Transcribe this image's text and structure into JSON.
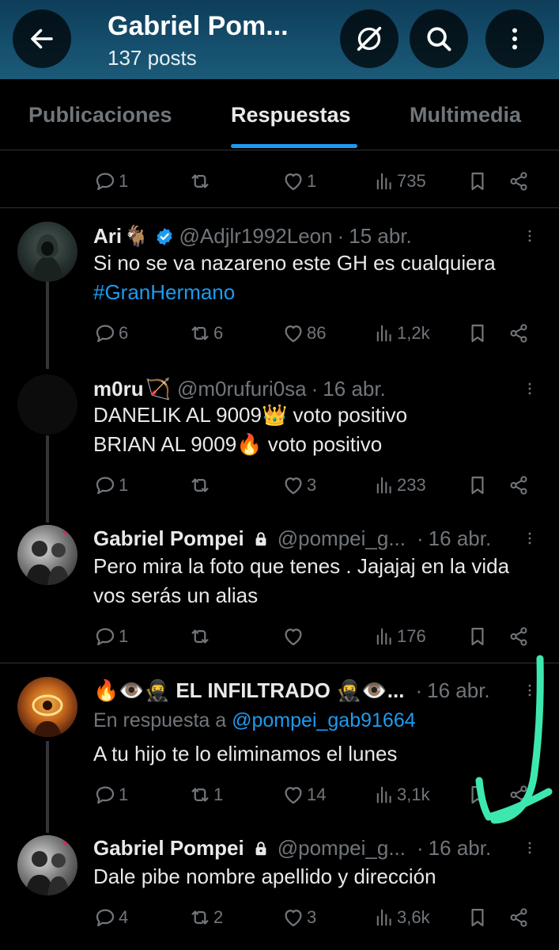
{
  "header": {
    "title": "Gabriel Pom...",
    "posts": "137 posts",
    "back_icon": "arrow-left-icon",
    "grok_icon": "grok-icon",
    "search_icon": "search-icon",
    "more_icon": "more-vertical-icon"
  },
  "tabs": [
    "Publicaciones",
    "Respuestas",
    "Multimedia"
  ],
  "active_tab": "Respuestas",
  "top_actions": {
    "replies": "1",
    "reposts": "",
    "likes": "1",
    "views": "735"
  },
  "posts": [
    {
      "name": "Ari",
      "name_emoji": "🐐",
      "verified": true,
      "handle": "@Adjlr1992Leon",
      "sep": "·",
      "date": "15 abr.",
      "lines": [
        "Si no se va nazareno este GH es cualquiera"
      ],
      "hashtag": "#GranHermano",
      "actions": {
        "replies": "6",
        "reposts": "6",
        "likes": "86",
        "views": "1,2k"
      }
    },
    {
      "name": "m0ru",
      "name_emoji": "🏹",
      "handle": "@m0rufuri0sa",
      "sep": "·",
      "date": "16 abr.",
      "lines": [
        "DANELIK AL 9009👑 voto positivo",
        "BRIAN AL 9009🔥 voto positivo"
      ],
      "actions": {
        "replies": "1",
        "reposts": "",
        "likes": "3",
        "views": "233"
      }
    },
    {
      "name": "Gabriel Pompei",
      "protected": true,
      "handle": "@pompei_g...",
      "sep": "·",
      "date": "16 abr.",
      "lines": [
        "Pero mira la foto que tenes . Jajajaj en la vida",
        "vos serás un alias"
      ],
      "actions": {
        "replies": "1",
        "reposts": "",
        "likes": "",
        "views": "176"
      }
    },
    {
      "name": "🔥👁️🥷 EL INFILTRADO 🥷👁️...",
      "handle": "",
      "sep": "·",
      "date": "16 abr.",
      "reply_label": "En respuesta a",
      "reply_handle": "@pompei_gab91664",
      "lines": [
        "A tu hijo te lo eliminamos el lunes"
      ],
      "actions": {
        "replies": "1",
        "reposts": "1",
        "likes": "14",
        "views": "3,1k"
      }
    },
    {
      "name": "Gabriel Pompei",
      "protected": true,
      "handle": "@pompei_g...",
      "sep": "·",
      "date": "16 abr.",
      "lines": [
        "Dale pibe nombre apellido y dirección"
      ],
      "actions": {
        "replies": "4",
        "reposts": "2",
        "likes": "3",
        "views": "3,6k"
      }
    }
  ],
  "colors": {
    "accent": "#1d9bf0",
    "muted": "#71767b",
    "text": "#e7e9ea",
    "annotation_arrow": "#3de8b0"
  }
}
